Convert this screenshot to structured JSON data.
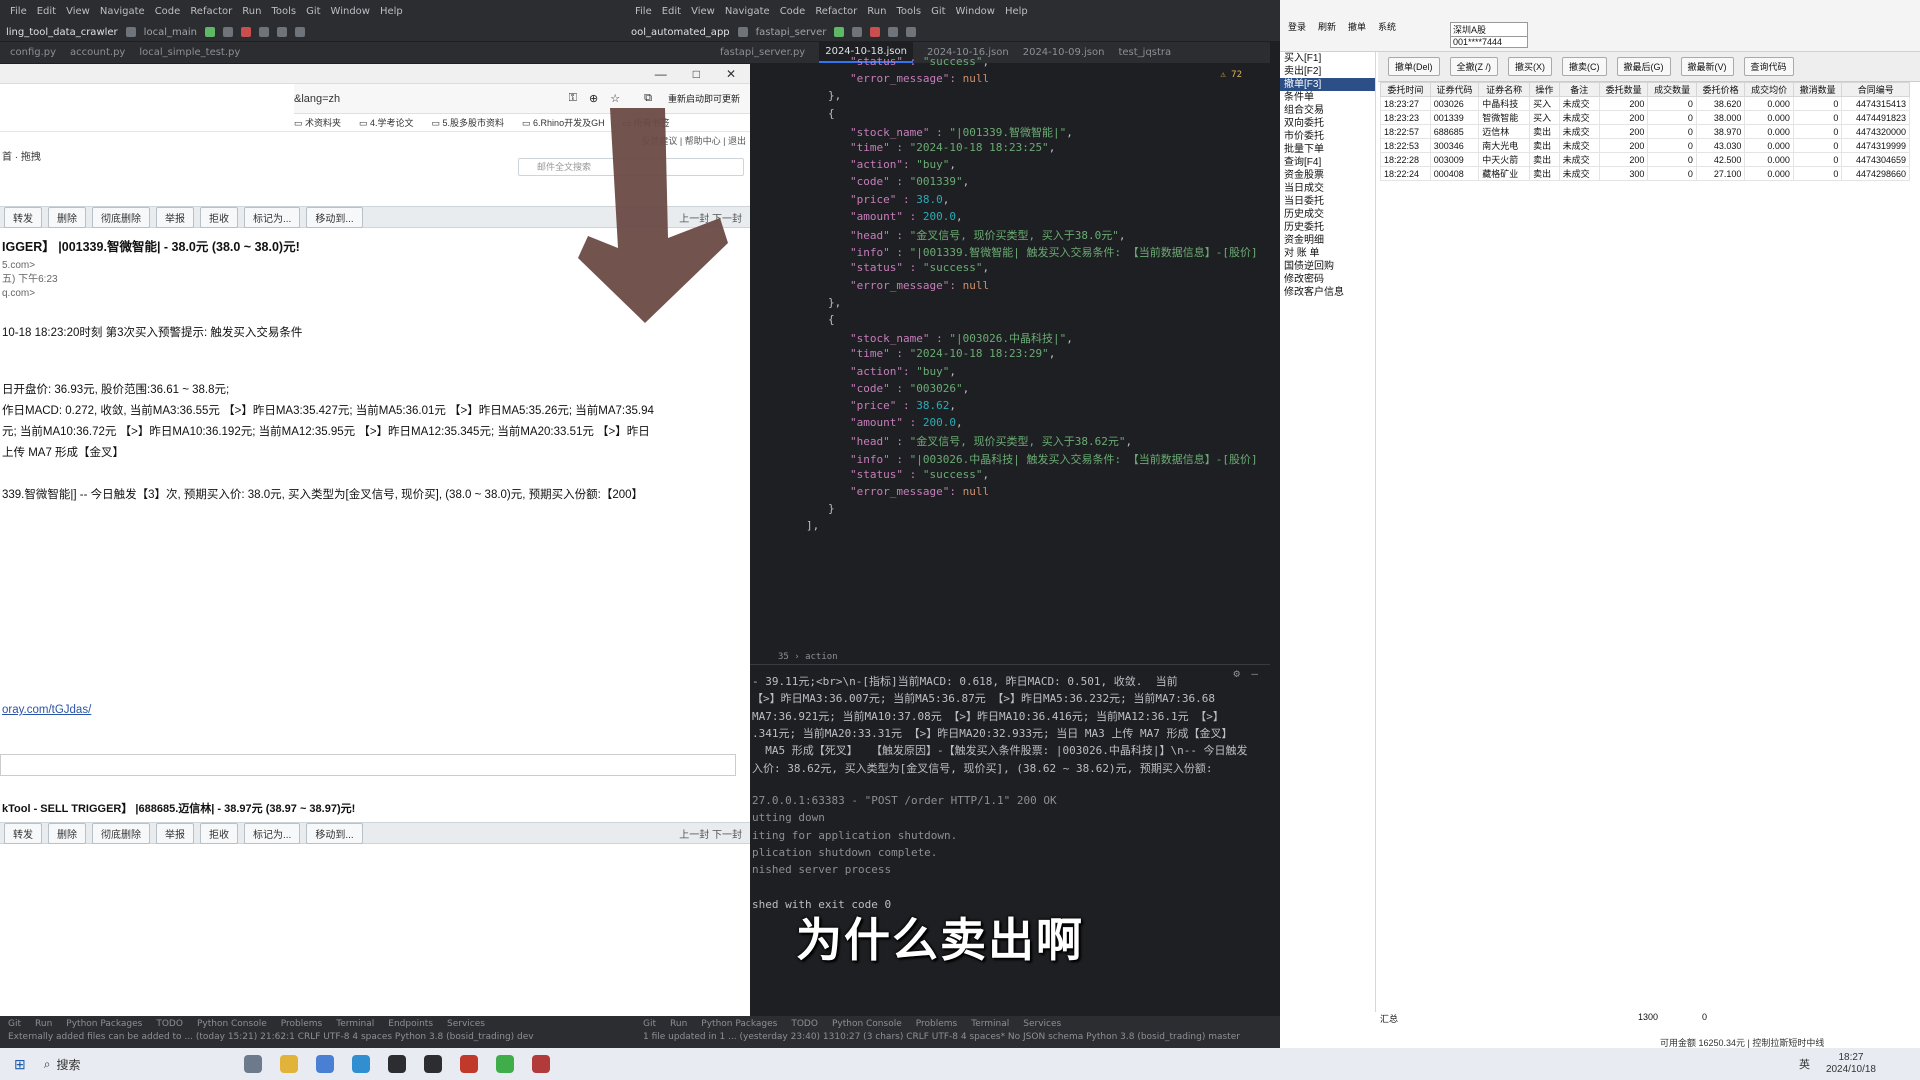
{
  "ide_left": {
    "menus": [
      "File",
      "Edit",
      "View",
      "Navigate",
      "Code",
      "Refactor",
      "Run",
      "Tools",
      "Git",
      "Window",
      "Help"
    ],
    "project": "ling_tool_data_crawler",
    "run_config": "local_main"
  },
  "ide_right": {
    "menus": [
      "File",
      "Edit",
      "View",
      "Navigate",
      "Code",
      "Refactor",
      "Run",
      "Tools",
      "Git",
      "Window",
      "Help"
    ],
    "project": "ool_automated_app",
    "run_config": "fastapi_server",
    "tabs": [
      "fastapi_server.py",
      "2024-10-18.json",
      "2024-10-16.json",
      "2024-10-09.json",
      "test_jqstra"
    ],
    "active_tab": "2024-10-18.json",
    "warn_count": "72",
    "breadcrumb": "35 › action"
  },
  "mail": {
    "url": "&lang=zh",
    "update_button": "重新启动即可更新",
    "bookmarks": [
      "术资料夹",
      "4.学考论文",
      "5.股多股市资料",
      "6.Rhino开发及GH",
      "所有书签"
    ],
    "top_links": "反馈建议 | 帮助中心 | 退出",
    "search_placeholder": "邮件全文搜索",
    "folder_crumb": "首 · 拖拽",
    "toolbar": [
      "转发",
      "删除",
      "彻底删除",
      "举报",
      "拒收",
      "标记为...",
      "移动到..."
    ],
    "pager": "上一封  下一封",
    "subject": "IGGER】 |001339.智微智能| - 38.0元 (38.0 ~ 38.0)元!",
    "from": "5.com>",
    "date": "五) 下午6:23",
    "to": "q.com>",
    "body": [
      "10-18 18:23:20时刻 第3次买入预警提示: 触发买入交易条件",
      "日开盘价: 36.93元, 股价范围:36.61 ~ 38.8元;",
      "作日MACD: 0.272, 收敛, 当前MA3:36.55元 【>】昨日MA3:35.427元; 当前MA5:36.01元 【>】昨日MA5:35.26元; 当前MA7:35.94",
      "元; 当前MA10:36.72元 【>】昨日MA10:36.192元; 当前MA12:35.95元 【>】昨日MA12:35.345元; 当前MA20:33.51元 【>】昨日",
      "上传 MA7 形成【金叉】",
      "339.智微智能|] -- 今日触发【3】次, 预期买入价: 38.0元, 买入类型为[金叉信号, 现价买], (38.0 ~ 38.0)元, 预期买入份额:【200】"
    ],
    "link": "oray.com/tGJdas/",
    "subject2": "kTool - SELL TRIGGER】 |688685.迈信林| - 38.97元 (38.97 ~ 38.97)元!"
  },
  "editor": {
    "lines": [
      {
        "t": "\"status\" : \"success\",",
        "indent": 3
      },
      {
        "t": "\"error_message\": null",
        "indent": 3
      },
      {
        "t": "},",
        "indent": 2
      },
      {
        "t": "{",
        "indent": 2
      },
      {
        "t": "\"stock_name\" : \"|001339.智微智能|\",",
        "indent": 3
      },
      {
        "t": "\"time\" : \"2024-10-18 18:23:25\",",
        "indent": 3
      },
      {
        "t": "\"action\": \"buy\",",
        "indent": 3
      },
      {
        "t": "\"code\" : \"001339\",",
        "indent": 3
      },
      {
        "t": "\"price\" : 38.0,",
        "indent": 3
      },
      {
        "t": "\"amount\" : 200.0,",
        "indent": 3
      },
      {
        "t": "\"head\" : \"金叉信号, 现价买类型, 买入于38.0元\",",
        "indent": 3
      },
      {
        "t": "\"info\" : \"|001339.智微智能| 触发买入交易条件: 【当前数据信息】-[股价]",
        "indent": 3
      },
      {
        "t": "\"status\" : \"success\",",
        "indent": 3
      },
      {
        "t": "\"error_message\": null",
        "indent": 3
      },
      {
        "t": "},",
        "indent": 2
      },
      {
        "t": "{",
        "indent": 2
      },
      {
        "t": "\"stock_name\" : \"|003026.中晶科技|\",",
        "indent": 3
      },
      {
        "t": "\"time\" : \"2024-10-18 18:23:29\",",
        "indent": 3
      },
      {
        "t": "\"action\": \"buy\",",
        "indent": 3
      },
      {
        "t": "\"code\" : \"003026\",",
        "indent": 3
      },
      {
        "t": "\"price\" : 38.62,",
        "indent": 3
      },
      {
        "t": "\"amount\" : 200.0,",
        "indent": 3
      },
      {
        "t": "\"head\" : \"金叉信号, 现价买类型, 买入于38.62元\",",
        "indent": 3
      },
      {
        "t": "\"info\" : \"|003026.中晶科技| 触发买入交易条件: 【当前数据信息】-[股价]",
        "indent": 3
      },
      {
        "t": "\"status\" : \"success\",",
        "indent": 3
      },
      {
        "t": "\"error_message\": null",
        "indent": 3
      },
      {
        "t": "}",
        "indent": 2
      },
      {
        "t": "],",
        "indent": 1
      }
    ]
  },
  "terminal": {
    "lines": [
      "- 39.11元;<br>\\n-[指标]当前MACD: 0.618, 昨日MACD: 0.501, 收敛.  当前",
      "【>】昨日MA3:36.007元; 当前MA5:36.87元 【>】昨日MA5:36.232元; 当前MA7:36.68",
      "MA7:36.921元; 当前MA10:37.08元 【>】昨日MA10:36.416元; 当前MA12:36.1元 【>】",
      ".341元; 当前MA20:33.31元 【>】昨日MA20:32.933元; 当日 MA3 上传 MA7 形成【金叉】",
      "  MA5 形成【死叉】  【触发原因】-【触发买入条件股票: |003026.中晶科技|】\\n-- 今日触发",
      "入价: 38.62元, 买入类型为[金叉信号, 现价买], (38.62 ~ 38.62)元, 预期买入份额:",
      "",
      "27.0.0.1:63383 - \"POST /order HTTP/1.1\" 200 OK",
      "utting down",
      "iting for application shutdown.",
      "plication shutdown complete.",
      "nished server process",
      "",
      "shed with exit code 0"
    ]
  },
  "trade": {
    "top_buttons": [
      "登录",
      "刷新",
      "撤单",
      "系统"
    ],
    "market": "深圳A股",
    "account": "001****7444",
    "side_menu": [
      "买入[F1]",
      "卖出[F2]",
      "撤单[F3]",
      "条件单",
      "组合交易",
      "双向委托",
      "市价委托",
      "批量下单",
      "查询[F4]",
      "资金股票",
      "当日成交",
      "当日委托",
      "历史成交",
      "历史委托",
      "资金明细",
      "对 账 单",
      "国债逆回购",
      "修改密码",
      "修改客户信息"
    ],
    "selected_side": "撤单[F3]",
    "action_buttons": [
      "撤单(Del)",
      "全撤(Z /)",
      "撤买(X)",
      "撤卖(C)",
      "撤最后(G)",
      "撤最新(V)",
      "查询代码"
    ],
    "columns": [
      "委托时间",
      "证券代码",
      "证券名称",
      "操作",
      "备注",
      "委托数量",
      "成交数量",
      "委托价格",
      "成交均价",
      "撤消数量",
      "合同编号"
    ],
    "rows": [
      [
        "18:23:27",
        "003026",
        "中晶科技",
        "买入",
        "未成交",
        "200",
        "0",
        "38.620",
        "0.000",
        "0",
        "4474315413"
      ],
      [
        "18:23:23",
        "001339",
        "智微智能",
        "买入",
        "未成交",
        "200",
        "0",
        "38.000",
        "0.000",
        "0",
        "4474491823"
      ],
      [
        "18:22:57",
        "688685",
        "迈信林",
        "卖出",
        "未成交",
        "200",
        "0",
        "38.970",
        "0.000",
        "0",
        "4474320000"
      ],
      [
        "18:22:53",
        "300346",
        "南大光电",
        "卖出",
        "未成交",
        "200",
        "0",
        "43.030",
        "0.000",
        "0",
        "4474319999"
      ],
      [
        "18:22:28",
        "003009",
        "中天火箭",
        "卖出",
        "未成交",
        "200",
        "0",
        "42.500",
        "0.000",
        "0",
        "4474304659"
      ],
      [
        "18:22:24",
        "000408",
        "藏格矿业",
        "卖出",
        "未成交",
        "300",
        "0",
        "27.100",
        "0.000",
        "0",
        "4474298660"
      ]
    ],
    "total_label": "汇总",
    "total_qty": "1300",
    "total_filled": "0",
    "footer": "可用金额  16250.34元  |  控制拉斯短时中线"
  },
  "status_left": "Externally added files can be added to ... (today 15:21)   21:62:1  CRLF  UTF-8  4 spaces  Python 3.8 (bosid_trading)  dev",
  "status_right": "1 file updated in 1 ... (yesterday 23:40)   1310:27 (3 chars)  CRLF  UTF-8  4 spaces*  No JSON schema  Python 3.8 (bosid_trading)  master",
  "taskbar": {
    "search_label": "搜索",
    "time": "18:27",
    "date": "2024/10/18",
    "lang": "英"
  },
  "subtitle": "为什么卖出啊"
}
